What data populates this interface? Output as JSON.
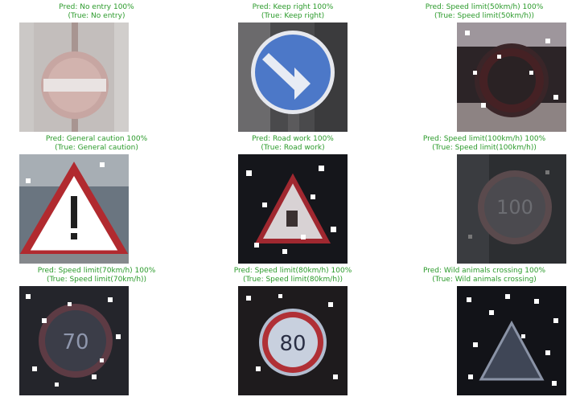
{
  "grid": [
    {
      "pred": "Pred: No entry 100%",
      "true": "(True: No entry)",
      "sign": "no-entry-sign"
    },
    {
      "pred": "Pred: Keep right 100%",
      "true": "(True: Keep right)",
      "sign": "keep-right-sign"
    },
    {
      "pred": "Pred: Speed limit(50km/h) 100%",
      "true": "(True: Speed limit(50km/h))",
      "sign": "speed-limit-sign"
    },
    {
      "pred": "Pred: General caution 100%",
      "true": "(True: General caution)",
      "sign": "general-caution-sign"
    },
    {
      "pred": "Pred: Road work 100%",
      "true": "(True: Road work)",
      "sign": "road-work-sign"
    },
    {
      "pred": "Pred: Speed limit(100km/h) 100%",
      "true": "(True: Speed limit(100km/h))",
      "sign": "speed-limit-sign"
    },
    {
      "pred": "Pred: Speed limit(70km/h) 100%",
      "true": "(True: Speed limit(70km/h))",
      "sign": "speed-limit-sign"
    },
    {
      "pred": "Pred: Speed limit(80km/h) 100%",
      "true": "(True: Speed limit(80km/h))",
      "sign": "speed-limit-sign"
    },
    {
      "pred": "Pred: Wild animals crossing 100%",
      "true": "(True: Wild animals crossing)",
      "sign": "wild-animals-crossing-sign"
    }
  ],
  "colors": {
    "caption": "#2a9a2a"
  }
}
